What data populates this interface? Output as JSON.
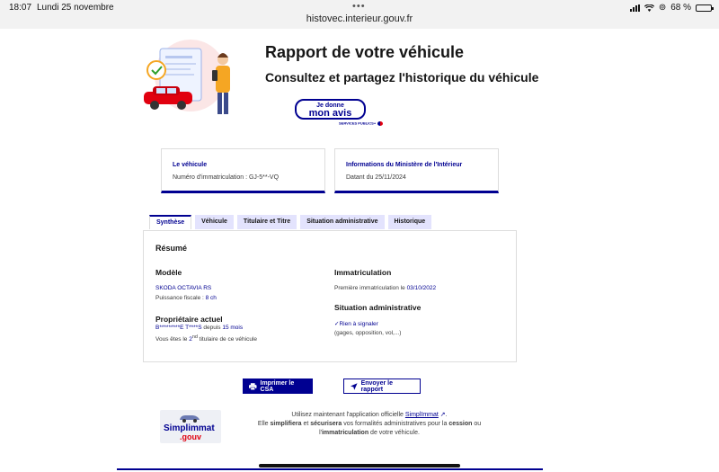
{
  "status_bar": {
    "time": "18:07",
    "date": "Lundi 25 novembre",
    "url": "histovec.interieur.gouv.fr",
    "battery": "68 %",
    "battery_level": 0.68
  },
  "header": {
    "title": "Rapport de votre véhicule",
    "subtitle": "Consultez et partagez l'historique du véhicule",
    "avis_line1": "Je donne",
    "avis_line2": "mon avis",
    "services_publics": "SERVICES PUBLICS+"
  },
  "cards": {
    "vehicule": {
      "title": "Le véhicule",
      "value": "Numéro d'immatriculation : GJ-5**-VQ"
    },
    "ministere": {
      "title": "Informations du Ministère de l'Intérieur",
      "value": "Datant du 25/11/2024"
    }
  },
  "tabs": [
    "Synthèse",
    "Véhicule",
    "Titulaire et Titre",
    "Situation administrative",
    "Historique"
  ],
  "synthese": {
    "heading": "Résumé",
    "modele_label": "Modèle",
    "modele_value": "SKODA OCTAVIA RS",
    "puissance_prefix": "Puissance fiscale : ",
    "puissance_value": "8 ch",
    "proprietaire_label": "Propriétaire actuel",
    "proprietaire_name": "B*********E T****S",
    "depuis_prefix": " depuis ",
    "depuis_value": "15 mois",
    "titulaire_prefix": "Vous êtes le ",
    "titulaire_rank": "2",
    "titulaire_sup": "nd",
    "titulaire_suffix": " titulaire de ce véhicule",
    "immat_label": "Immatriculation",
    "immat_prefix": "Première immatriculation le ",
    "immat_date": "03/10/2022",
    "situation_label": "Situation administrative",
    "situation_value": "Rien à signaler",
    "situation_note": "(gages, opposition, vol,...)"
  },
  "actions": {
    "print_label": "Imprimer le CSA",
    "send_label": "Envoyer le rapport"
  },
  "promo": {
    "logo_line1": "Simplimmat",
    "logo_line2": ".gouv",
    "line1_prefix": "Utilisez maintenant l'application officielle ",
    "app_link": "SimplImmat",
    "line1_suffix": ".",
    "line2_a": "Elle ",
    "line2_b": "simplifiera",
    "line2_c": " et ",
    "line2_d": "sécurisera",
    "line2_e": " vos formalités administratives pour la ",
    "line2_f": "cession",
    "line2_g": " ou",
    "line3_a": "l'",
    "line3_b": "immatriculation",
    "line3_c": " de votre véhicule."
  },
  "colors": {
    "primary": "#000091",
    "accent": "#e1000f",
    "tab_bg": "#e3e3fd"
  },
  "icons": [
    "printer-icon",
    "send-icon",
    "check-icon",
    "external-link-icon",
    "wifi-icon",
    "signal-icon",
    "battery-icon"
  ]
}
